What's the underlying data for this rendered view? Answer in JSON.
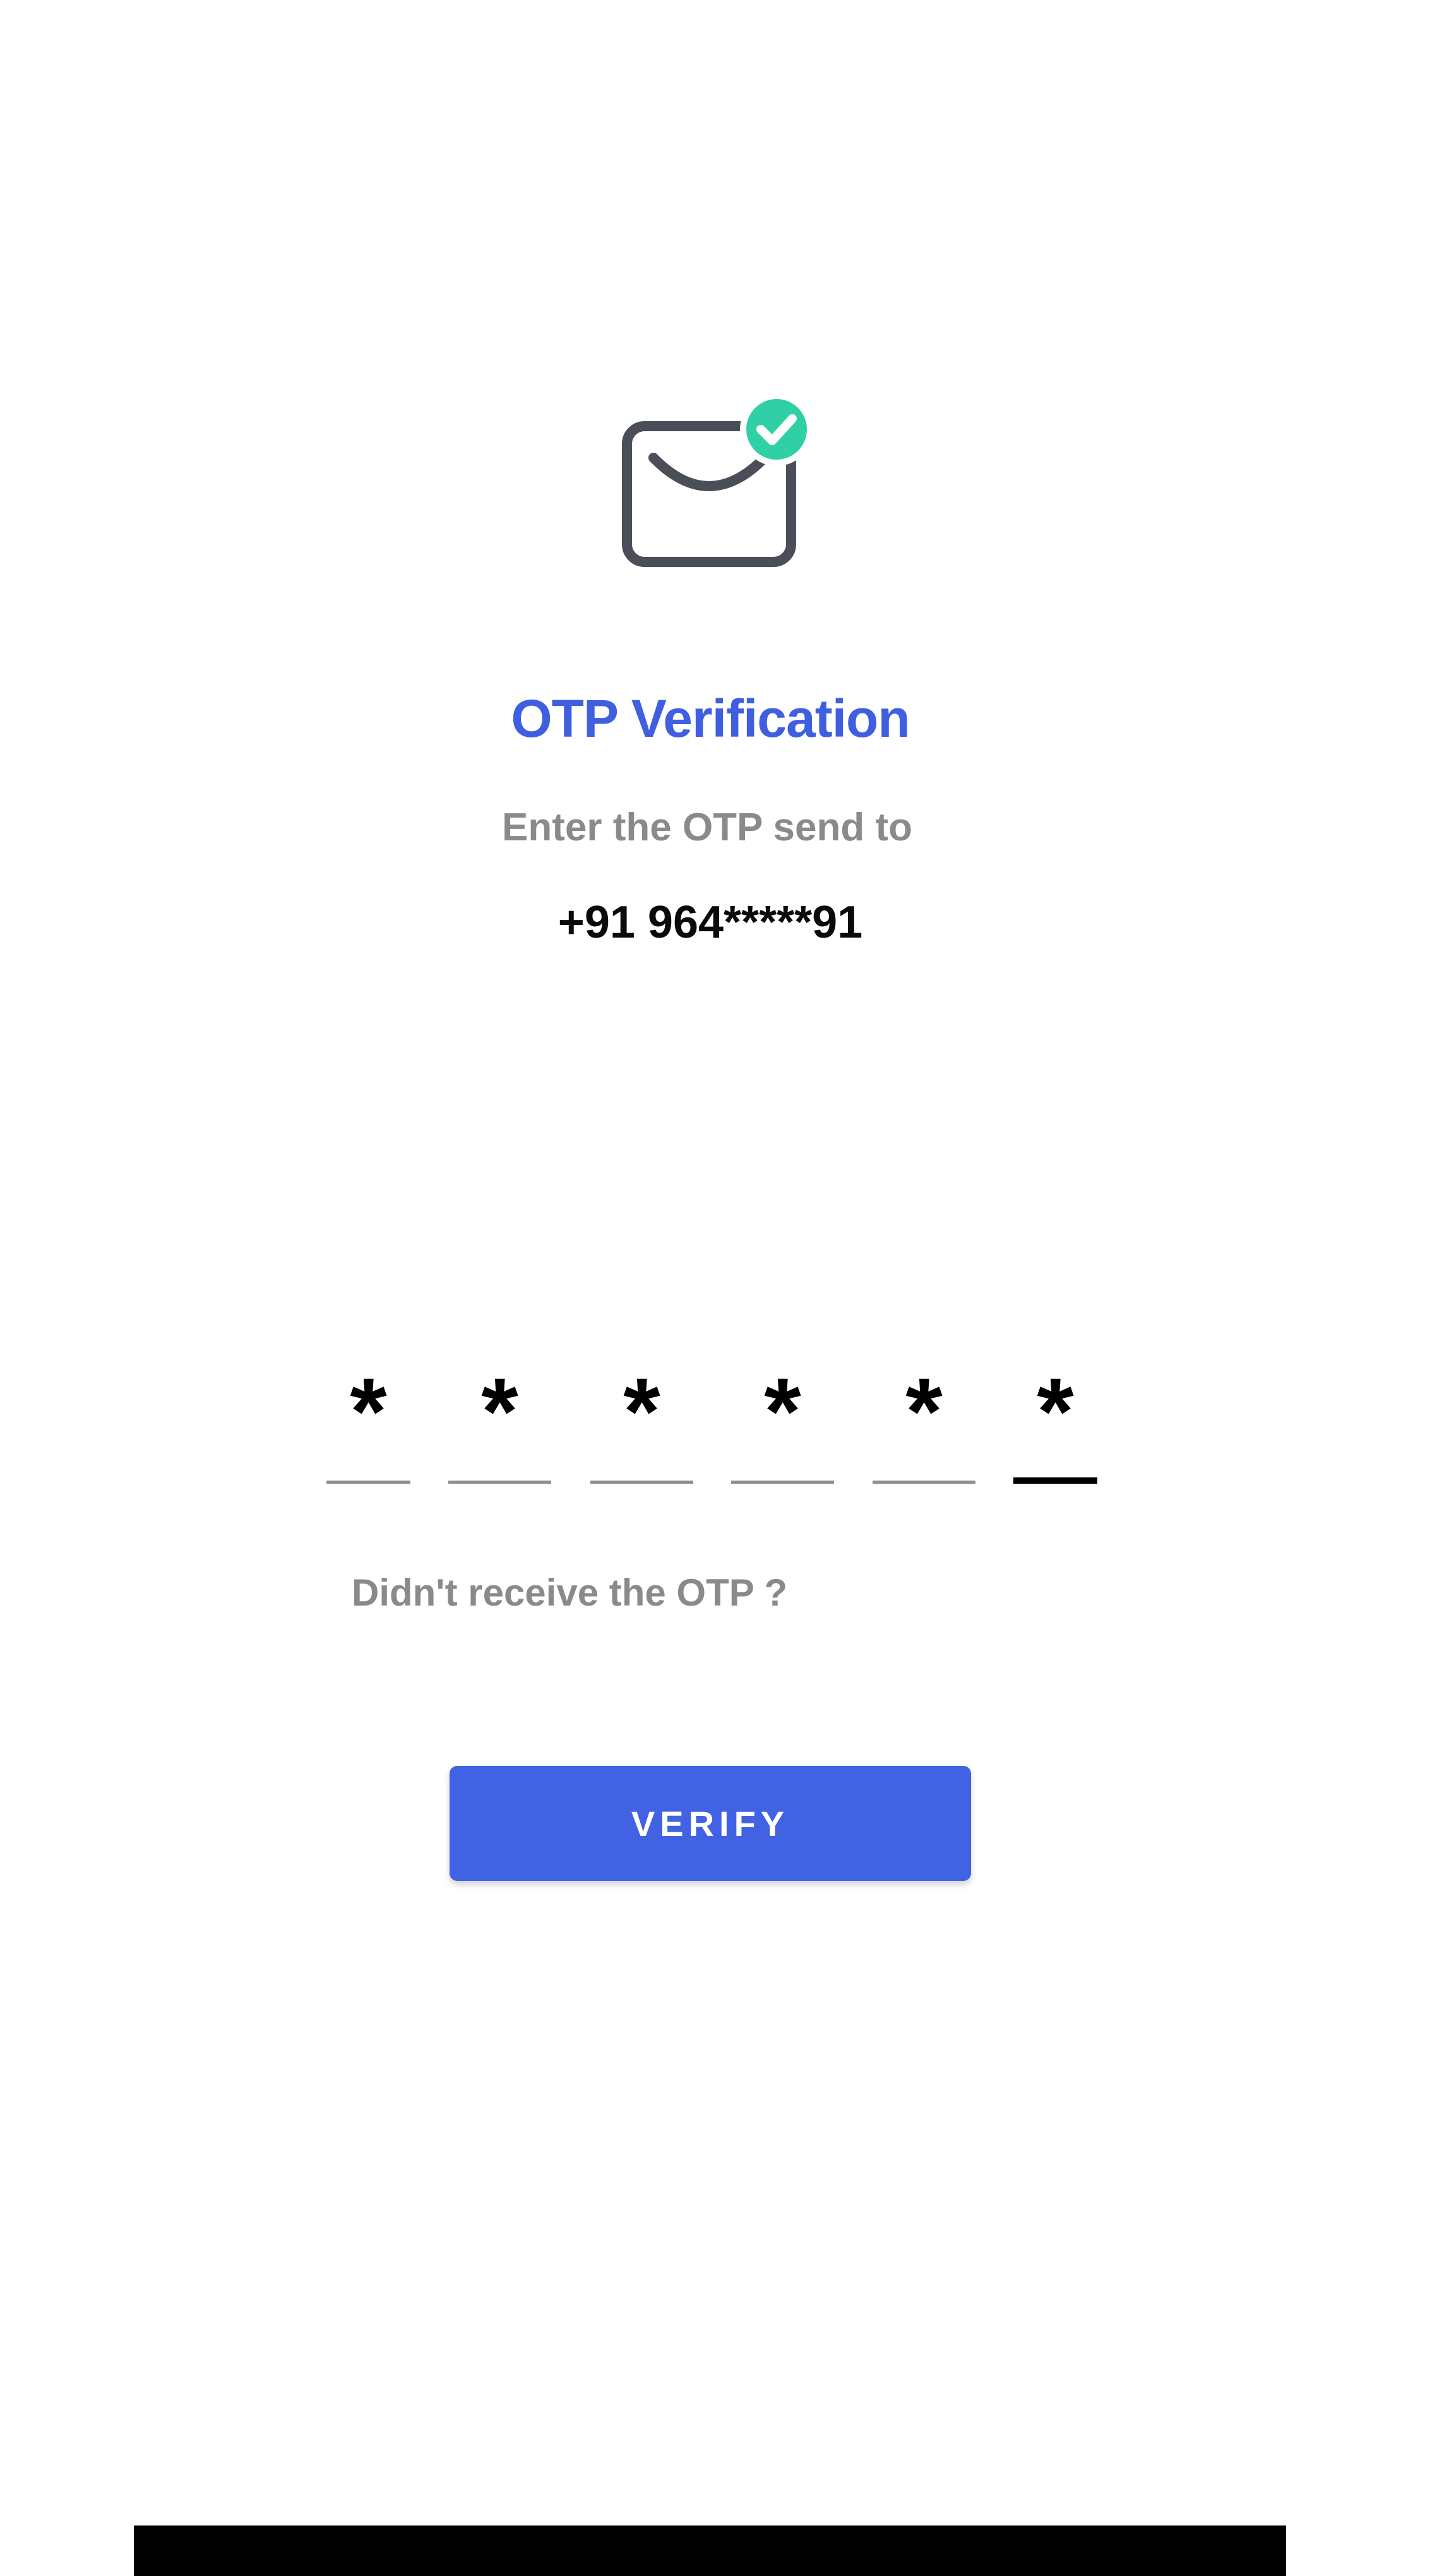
{
  "header": {
    "title": "OTP Verification",
    "subtitle": "Enter the OTP send to",
    "phone": "+91 964*****91"
  },
  "icons": {
    "envelope": "envelope-check-icon"
  },
  "otp": {
    "digits": [
      "*",
      "*",
      "*",
      "*",
      "*",
      "*"
    ],
    "active_index": 5
  },
  "resend": {
    "label": "Didn't receive the OTP ?"
  },
  "actions": {
    "verify_label": "VERIFY"
  },
  "colors": {
    "accent": "#4262e4",
    "title": "#3f5fe0",
    "check_badge": "#2fd0a5",
    "muted_text": "#8a8a8a"
  }
}
